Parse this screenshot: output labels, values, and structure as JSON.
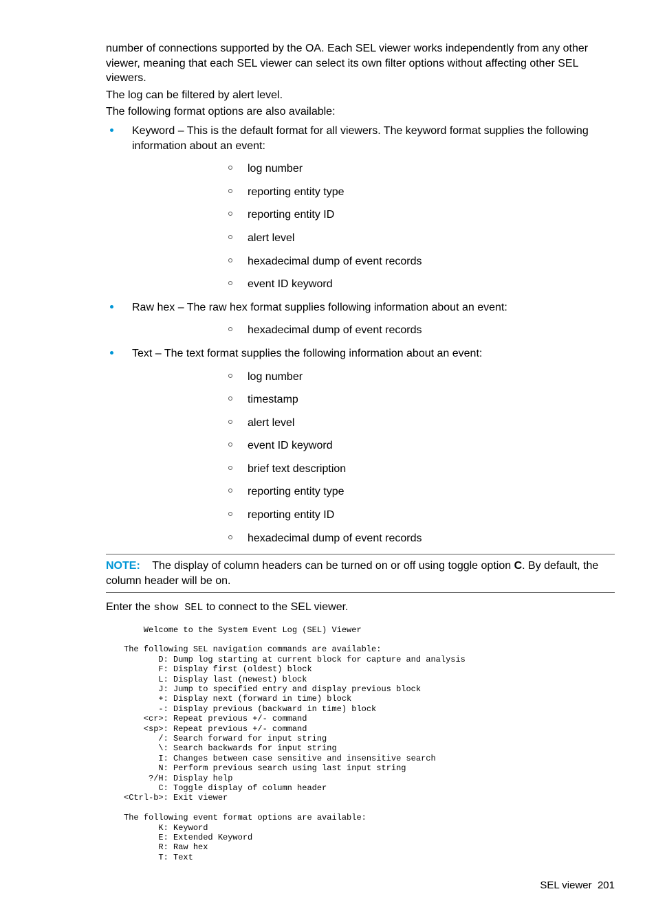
{
  "intro_para": "number of connections supported by the OA. Each SEL viewer works independently from any other viewer, meaning that each SEL viewer can select its own filter options without affecting other SEL viewers.",
  "filter_para": "The log can be filtered by alert level.",
  "formatopts_para": "The following format options are also available:",
  "keyword_bullet": "Keyword – This is the default format for all viewers. The keyword format supplies the following information about an event:",
  "keyword_sub": [
    "log number",
    "reporting entity type",
    "reporting entity ID",
    "alert level",
    "hexadecimal dump of event records",
    "event ID keyword"
  ],
  "rawhex_bullet": "Raw hex – The raw hex format supplies following information about an event:",
  "rawhex_sub": [
    "hexadecimal dump of event records"
  ],
  "text_bullet": "Text – The text format supplies the following information about an event:",
  "text_sub": [
    "log number",
    "timestamp",
    "alert level",
    "event ID keyword",
    "brief text description",
    "reporting entity type",
    "reporting entity ID",
    "hexadecimal dump of event records"
  ],
  "note_label": "NOTE:",
  "note_text_1": "The display of column headers can be turned on or off using toggle option ",
  "note_bold": "C",
  "note_text_2": ". By default, the column header will be on.",
  "enter_prefix": "Enter the ",
  "enter_cmd": "show SEL",
  "enter_suffix": " to connect to the SEL viewer.",
  "codeblock": "    Welcome to the System Event Log (SEL) Viewer\n\nThe following SEL navigation commands are available:\n       D: Dump log starting at current block for capture and analysis\n       F: Display first (oldest) block\n       L: Display last (newest) block\n       J: Jump to specified entry and display previous block\n       +: Display next (forward in time) block\n       -: Display previous (backward in time) block\n    <cr>: Repeat previous +/- command\n    <sp>: Repeat previous +/- command\n       /: Search forward for input string\n       \\: Search backwards for input string\n       I: Changes between case sensitive and insensitive search\n       N: Perform previous search using last input string\n     ?/H: Display help\n       C: Toggle display of column header\n<Ctrl-b>: Exit viewer\n\nThe following event format options are available:\n       K: Keyword\n       E: Extended Keyword\n       R: Raw hex\n       T: Text",
  "footer_section": "SEL viewer",
  "footer_page": "201"
}
